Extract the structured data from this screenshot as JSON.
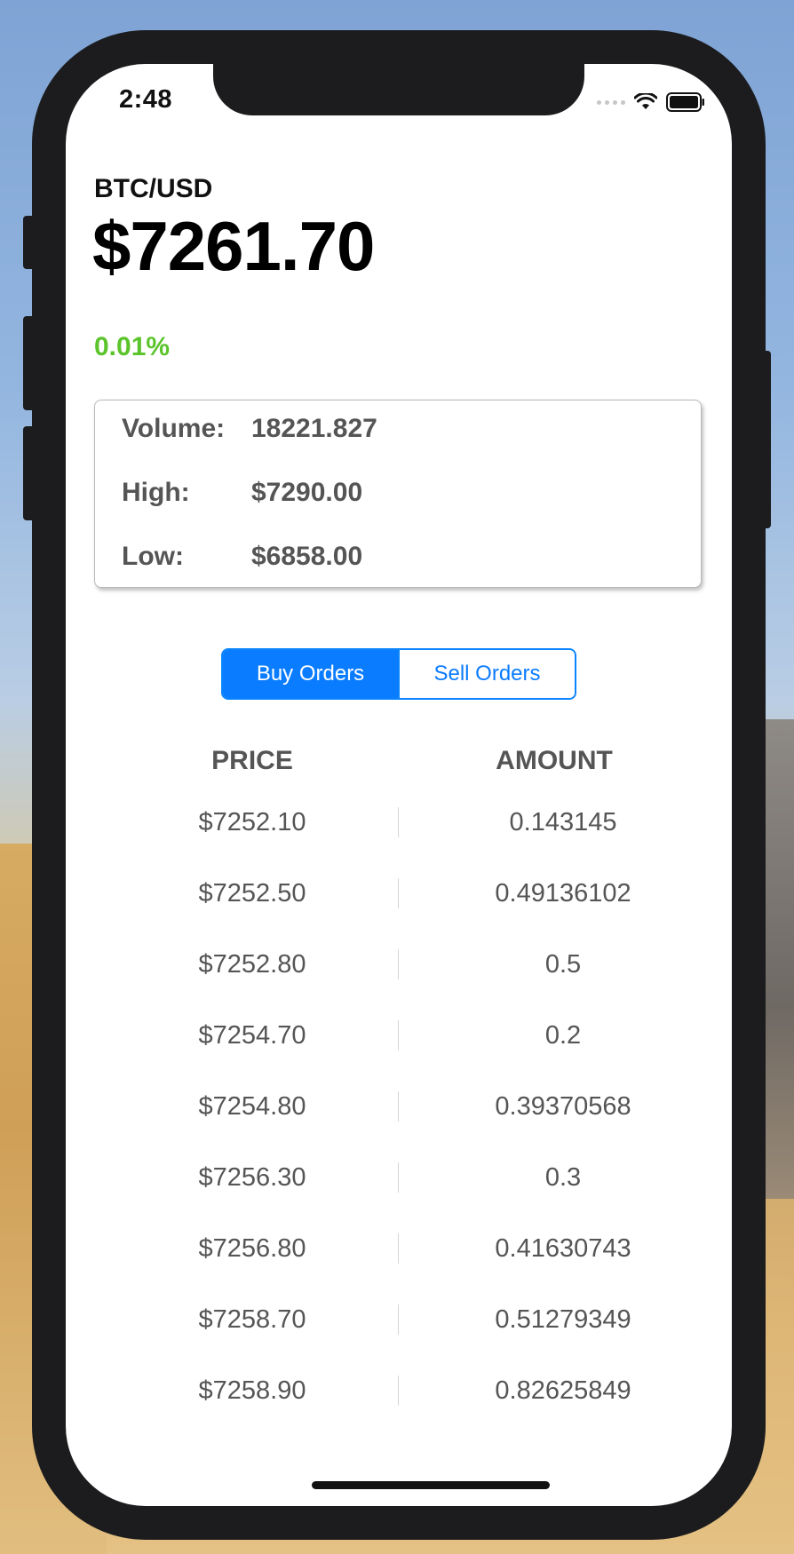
{
  "status_bar": {
    "time": "2:48"
  },
  "ticker": {
    "pair": "BTC/USD",
    "price": "$7261.70",
    "change": "0.01%"
  },
  "stats": {
    "volume_label": "Volume:",
    "volume_value": "18221.827",
    "high_label": "High:",
    "high_value": "$7290.00",
    "low_label": "Low:",
    "low_value": "$6858.00"
  },
  "segmented": {
    "buy_label": "Buy Orders",
    "sell_label": "Sell Orders",
    "selected": "Buy Orders"
  },
  "table": {
    "headers": {
      "price": "PRICE",
      "amount": "AMOUNT"
    },
    "rows": [
      {
        "price": "$7252.10",
        "amount": "0.143145"
      },
      {
        "price": "$7252.50",
        "amount": "0.49136102"
      },
      {
        "price": "$7252.80",
        "amount": "0.5"
      },
      {
        "price": "$7254.70",
        "amount": "0.2"
      },
      {
        "price": "$7254.80",
        "amount": "0.39370568"
      },
      {
        "price": "$7256.30",
        "amount": "0.3"
      },
      {
        "price": "$7256.80",
        "amount": "0.41630743"
      },
      {
        "price": "$7258.70",
        "amount": "0.51279349"
      },
      {
        "price": "$7258.90",
        "amount": "0.82625849"
      }
    ]
  },
  "colors": {
    "accent": "#0a7cff",
    "positive": "#5bc42b",
    "text_secondary": "#555555"
  }
}
